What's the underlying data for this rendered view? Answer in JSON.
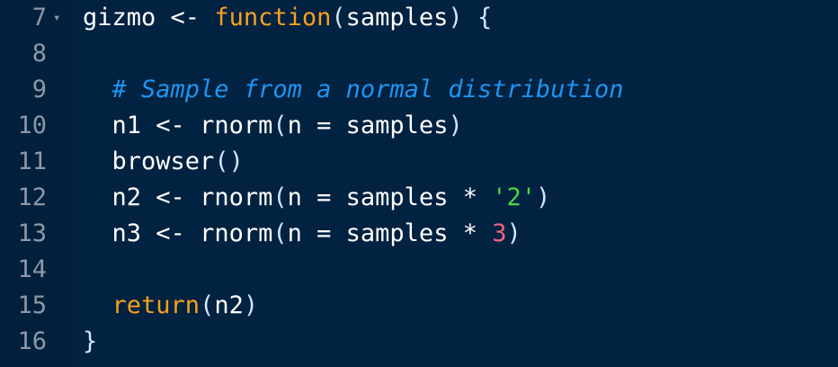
{
  "editor": {
    "fold_glyph": "▾",
    "lines": [
      {
        "number": "7",
        "segments": [
          {
            "text": "gizmo",
            "type": "id"
          },
          {
            "text": " <- ",
            "type": "op"
          },
          {
            "text": "function",
            "type": "kw"
          },
          {
            "text": "(",
            "type": "br"
          },
          {
            "text": "samples",
            "type": "id"
          },
          {
            "text": ")",
            "type": "br"
          },
          {
            "text": " ",
            "type": "op"
          },
          {
            "text": "{",
            "type": "br"
          }
        ]
      },
      {
        "number": "8",
        "segments": []
      },
      {
        "number": "9",
        "segments": [
          {
            "text": "  ",
            "type": "op"
          },
          {
            "text": "# Sample from a normal distribution",
            "type": "cm"
          }
        ]
      },
      {
        "number": "10",
        "segments": [
          {
            "text": "  n1",
            "type": "id"
          },
          {
            "text": " <- ",
            "type": "op"
          },
          {
            "text": "rnorm",
            "type": "id"
          },
          {
            "text": "(",
            "type": "br"
          },
          {
            "text": "n",
            "type": "id"
          },
          {
            "text": " = ",
            "type": "op"
          },
          {
            "text": "samples",
            "type": "id"
          },
          {
            "text": ")",
            "type": "br"
          }
        ]
      },
      {
        "number": "11",
        "segments": [
          {
            "text": "  browser",
            "type": "id"
          },
          {
            "text": "()",
            "type": "br"
          }
        ]
      },
      {
        "number": "12",
        "segments": [
          {
            "text": "  n2",
            "type": "id"
          },
          {
            "text": " <- ",
            "type": "op"
          },
          {
            "text": "rnorm",
            "type": "id"
          },
          {
            "text": "(",
            "type": "br"
          },
          {
            "text": "n",
            "type": "id"
          },
          {
            "text": " = ",
            "type": "op"
          },
          {
            "text": "samples",
            "type": "id"
          },
          {
            "text": " * ",
            "type": "op"
          },
          {
            "text": "'2'",
            "type": "str"
          },
          {
            "text": ")",
            "type": "br"
          }
        ]
      },
      {
        "number": "13",
        "segments": [
          {
            "text": "  n3",
            "type": "id"
          },
          {
            "text": " <- ",
            "type": "op"
          },
          {
            "text": "rnorm",
            "type": "id"
          },
          {
            "text": "(",
            "type": "br"
          },
          {
            "text": "n",
            "type": "id"
          },
          {
            "text": " = ",
            "type": "op"
          },
          {
            "text": "samples",
            "type": "id"
          },
          {
            "text": " * ",
            "type": "op"
          },
          {
            "text": "3",
            "type": "num"
          },
          {
            "text": ")",
            "type": "br"
          }
        ]
      },
      {
        "number": "14",
        "segments": []
      },
      {
        "number": "15",
        "segments": [
          {
            "text": "  ",
            "type": "op"
          },
          {
            "text": "return",
            "type": "kw"
          },
          {
            "text": "(",
            "type": "br"
          },
          {
            "text": "n2",
            "type": "id"
          },
          {
            "text": ")",
            "type": "br"
          }
        ]
      },
      {
        "number": "16",
        "segments": [
          {
            "text": "}",
            "type": "br"
          }
        ]
      }
    ]
  },
  "colors": {
    "background": "#012240",
    "keyword": "#f7a11f",
    "comment": "#1e94f2",
    "string": "#44d94a",
    "number": "#f26480",
    "line_number": "#8c98a6"
  }
}
